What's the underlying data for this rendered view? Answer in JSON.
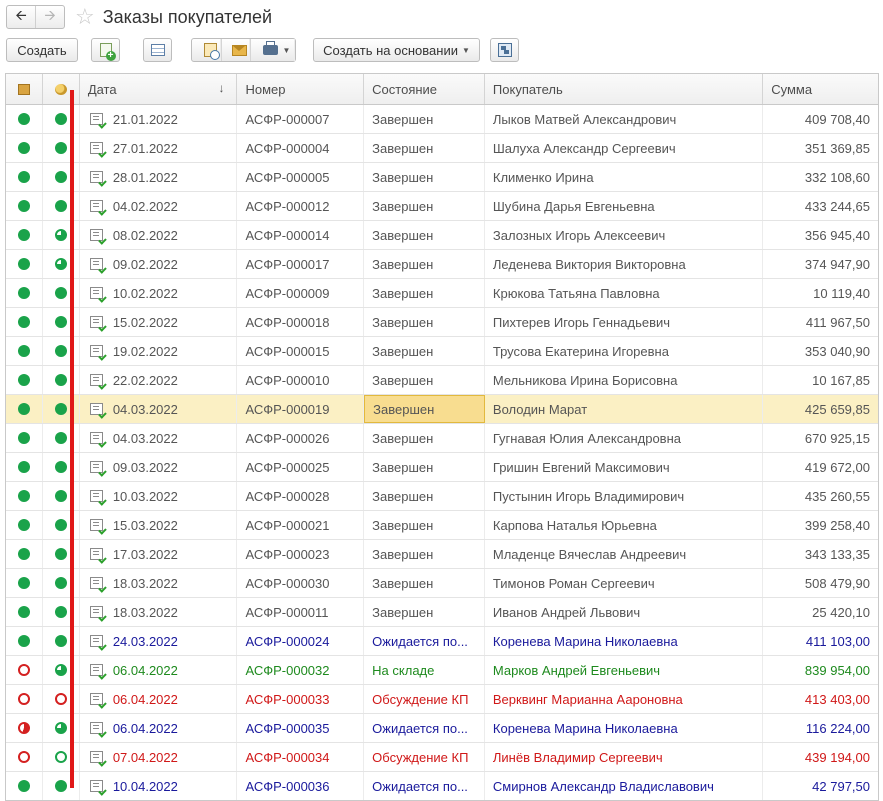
{
  "window": {
    "title": "Заказы покупателей",
    "back_icon": "arrow-left-icon",
    "forward_icon": "arrow-right-icon",
    "favorite_icon": "star-icon"
  },
  "toolbar": {
    "create_label": "Создать",
    "create_based_on_label": "Создать на основании"
  },
  "columns": {
    "date": "Дата",
    "number": "Номер",
    "status": "Состояние",
    "customer": "Покупатель",
    "amount": "Сумма"
  },
  "colors": {
    "default_text": "#555555",
    "posted_text": "#1a1a9c",
    "green_text": "#1e8a1e",
    "red_text": "#d01818",
    "selected_row": "#fbf0c4",
    "marker": "#e01818"
  },
  "rows": [
    {
      "shipment": "full",
      "payment": "full",
      "date": "21.01.2022",
      "number": "АСФР-000007",
      "status": "Завершен",
      "customer": "Лыков Матвей Александрович",
      "amount": "409 708,40",
      "tone": "default"
    },
    {
      "shipment": "full",
      "payment": "full",
      "date": "27.01.2022",
      "number": "АСФР-000004",
      "status": "Завершен",
      "customer": "Шалуха Александр Сергеевич",
      "amount": "351 369,85",
      "tone": "default"
    },
    {
      "shipment": "full",
      "payment": "full",
      "date": "28.01.2022",
      "number": "АСФР-000005",
      "status": "Завершен",
      "customer": "Клименко Ирина",
      "amount": "332 108,60",
      "tone": "default"
    },
    {
      "shipment": "full",
      "payment": "full",
      "date": "04.02.2022",
      "number": "АСФР-000012",
      "status": "Завершен",
      "customer": "Шубина Дарья Евгеньевна",
      "amount": "433 244,65",
      "tone": "default"
    },
    {
      "shipment": "full",
      "payment": "pie-green",
      "date": "08.02.2022",
      "number": "АСФР-000014",
      "status": "Завершен",
      "customer": "Залозных Игорь Алексеевич",
      "amount": "356 945,40",
      "tone": "default"
    },
    {
      "shipment": "full",
      "payment": "pie-green",
      "date": "09.02.2022",
      "number": "АСФР-000017",
      "status": "Завершен",
      "customer": "Леденева Виктория Викторовна",
      "amount": "374 947,90",
      "tone": "default"
    },
    {
      "shipment": "full",
      "payment": "full",
      "date": "10.02.2022",
      "number": "АСФР-000009",
      "status": "Завершен",
      "customer": "Крюкова Татьяна Павловна",
      "amount": "10 119,40",
      "tone": "default"
    },
    {
      "shipment": "full",
      "payment": "full",
      "date": "15.02.2022",
      "number": "АСФР-000018",
      "status": "Завершен",
      "customer": "Пихтерев Игорь Геннадьевич",
      "amount": "411 967,50",
      "tone": "default"
    },
    {
      "shipment": "full",
      "payment": "full",
      "date": "19.02.2022",
      "number": "АСФР-000015",
      "status": "Завершен",
      "customer": "Трусова Екатерина Игоревна",
      "amount": "353 040,90",
      "tone": "default"
    },
    {
      "shipment": "full",
      "payment": "full",
      "date": "22.02.2022",
      "number": "АСФР-000010",
      "status": "Завершен",
      "customer": "Мельникова Ирина Борисовна",
      "amount": "10 167,85",
      "tone": "default"
    },
    {
      "shipment": "full",
      "payment": "full",
      "date": "04.03.2022",
      "number": "АСФР-000019",
      "status": "Завершен",
      "customer": "Володин Марат",
      "amount": "425 659,85",
      "tone": "default",
      "selected": true
    },
    {
      "shipment": "full",
      "payment": "full",
      "date": "04.03.2022",
      "number": "АСФР-000026",
      "status": "Завершен",
      "customer": "Гугнавая Юлия Александровна",
      "amount": "670 925,15",
      "tone": "default"
    },
    {
      "shipment": "full",
      "payment": "full",
      "date": "09.03.2022",
      "number": "АСФР-000025",
      "status": "Завершен",
      "customer": "Гришин Евгений Максимович",
      "amount": "419 672,00",
      "tone": "default"
    },
    {
      "shipment": "full",
      "payment": "full",
      "date": "10.03.2022",
      "number": "АСФР-000028",
      "status": "Завершен",
      "customer": "Пустынин Игорь Владимирович",
      "amount": "435 260,55",
      "tone": "default"
    },
    {
      "shipment": "full",
      "payment": "full",
      "date": "15.03.2022",
      "number": "АСФР-000021",
      "status": "Завершен",
      "customer": "Карпова Наталья Юрьевна",
      "amount": "399 258,40",
      "tone": "default"
    },
    {
      "shipment": "full",
      "payment": "full",
      "date": "17.03.2022",
      "number": "АСФР-000023",
      "status": "Завершен",
      "customer": "Младенце Вячеслав Андреевич",
      "amount": "343 133,35",
      "tone": "default"
    },
    {
      "shipment": "full",
      "payment": "full",
      "date": "18.03.2022",
      "number": "АСФР-000030",
      "status": "Завершен",
      "customer": "Тимонов Роман Сергеевич",
      "amount": "508 479,90",
      "tone": "default"
    },
    {
      "shipment": "full",
      "payment": "full",
      "date": "18.03.2022",
      "number": "АСФР-000011",
      "status": "Завершен",
      "customer": "Иванов Андрей Львович",
      "amount": "25 420,10",
      "tone": "default"
    },
    {
      "shipment": "full",
      "payment": "full",
      "date": "24.03.2022",
      "number": "АСФР-000024",
      "status": "Ожидается по...",
      "customer": "Коренева Марина Николаевна",
      "amount": "411 103,00",
      "tone": "posted"
    },
    {
      "shipment": "hollow-red",
      "payment": "pie-green",
      "date": "06.04.2022",
      "number": "АСФР-000032",
      "status": "На складе",
      "customer": "Марков Андрей Евгеньевич",
      "amount": "839 954,00",
      "tone": "green"
    },
    {
      "shipment": "hollow-red",
      "payment": "hollow-red",
      "date": "06.04.2022",
      "number": "АСФР-000033",
      "status": "Обсуждение КП",
      "customer": "Верквинг Марианна Аароновна",
      "amount": "413 403,00",
      "tone": "red"
    },
    {
      "shipment": "pie-red",
      "payment": "pie-green",
      "date": "06.04.2022",
      "number": "АСФР-000035",
      "status": "Ожидается по...",
      "customer": "Коренева Марина Николаевна",
      "amount": "116 224,00",
      "tone": "posted"
    },
    {
      "shipment": "hollow-red",
      "payment": "hollow-green",
      "date": "07.04.2022",
      "number": "АСФР-000034",
      "status": "Обсуждение КП",
      "customer": "Линёв Владимир Сергеевич",
      "amount": "439 194,00",
      "tone": "red"
    },
    {
      "shipment": "full",
      "payment": "full",
      "date": "10.04.2022",
      "number": "АСФР-000036",
      "status": "Ожидается по...",
      "customer": "Смирнов Александр Владиславович",
      "amount": "42 797,50",
      "tone": "posted"
    }
  ]
}
